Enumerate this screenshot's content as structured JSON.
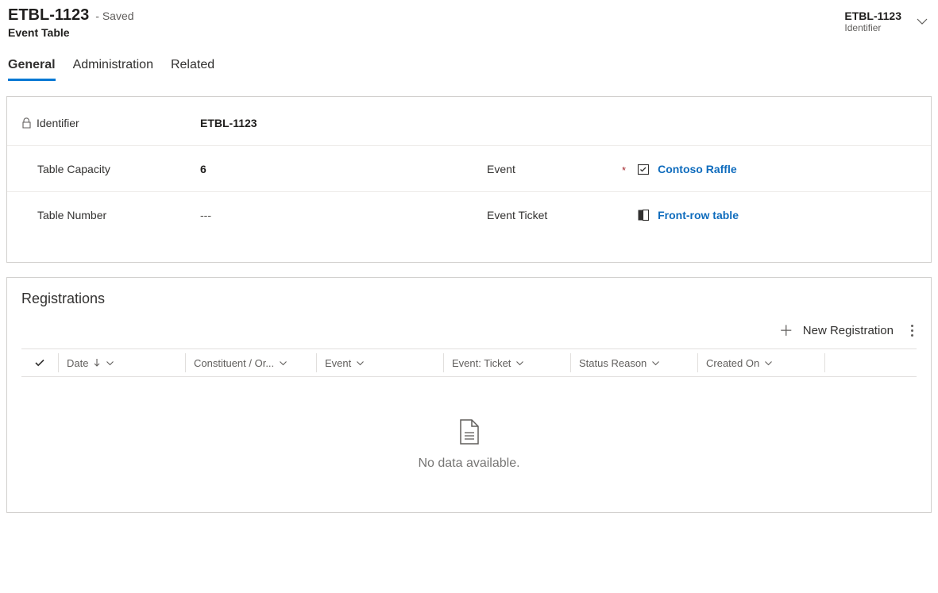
{
  "header": {
    "title": "ETBL-1123",
    "saved": "- Saved",
    "entity": "Event Table",
    "identifier_value": "ETBL-1123",
    "identifier_label": "Identifier"
  },
  "tabs": {
    "general": "General",
    "administration": "Administration",
    "related": "Related"
  },
  "form": {
    "identifier_label": "Identifier",
    "identifier_value": "ETBL-1123",
    "capacity_label": "Table Capacity",
    "capacity_value": "6",
    "event_label": "Event",
    "event_value": "Contoso Raffle",
    "number_label": "Table Number",
    "number_value": "---",
    "ticket_label": "Event Ticket",
    "ticket_value": "Front-row table"
  },
  "registrations": {
    "title": "Registrations",
    "new_btn": "New Registration",
    "columns": {
      "date": "Date",
      "constituent": "Constituent / Or...",
      "event": "Event",
      "ticket": "Event: Ticket",
      "status": "Status Reason",
      "created": "Created On"
    },
    "empty": "No data available."
  }
}
